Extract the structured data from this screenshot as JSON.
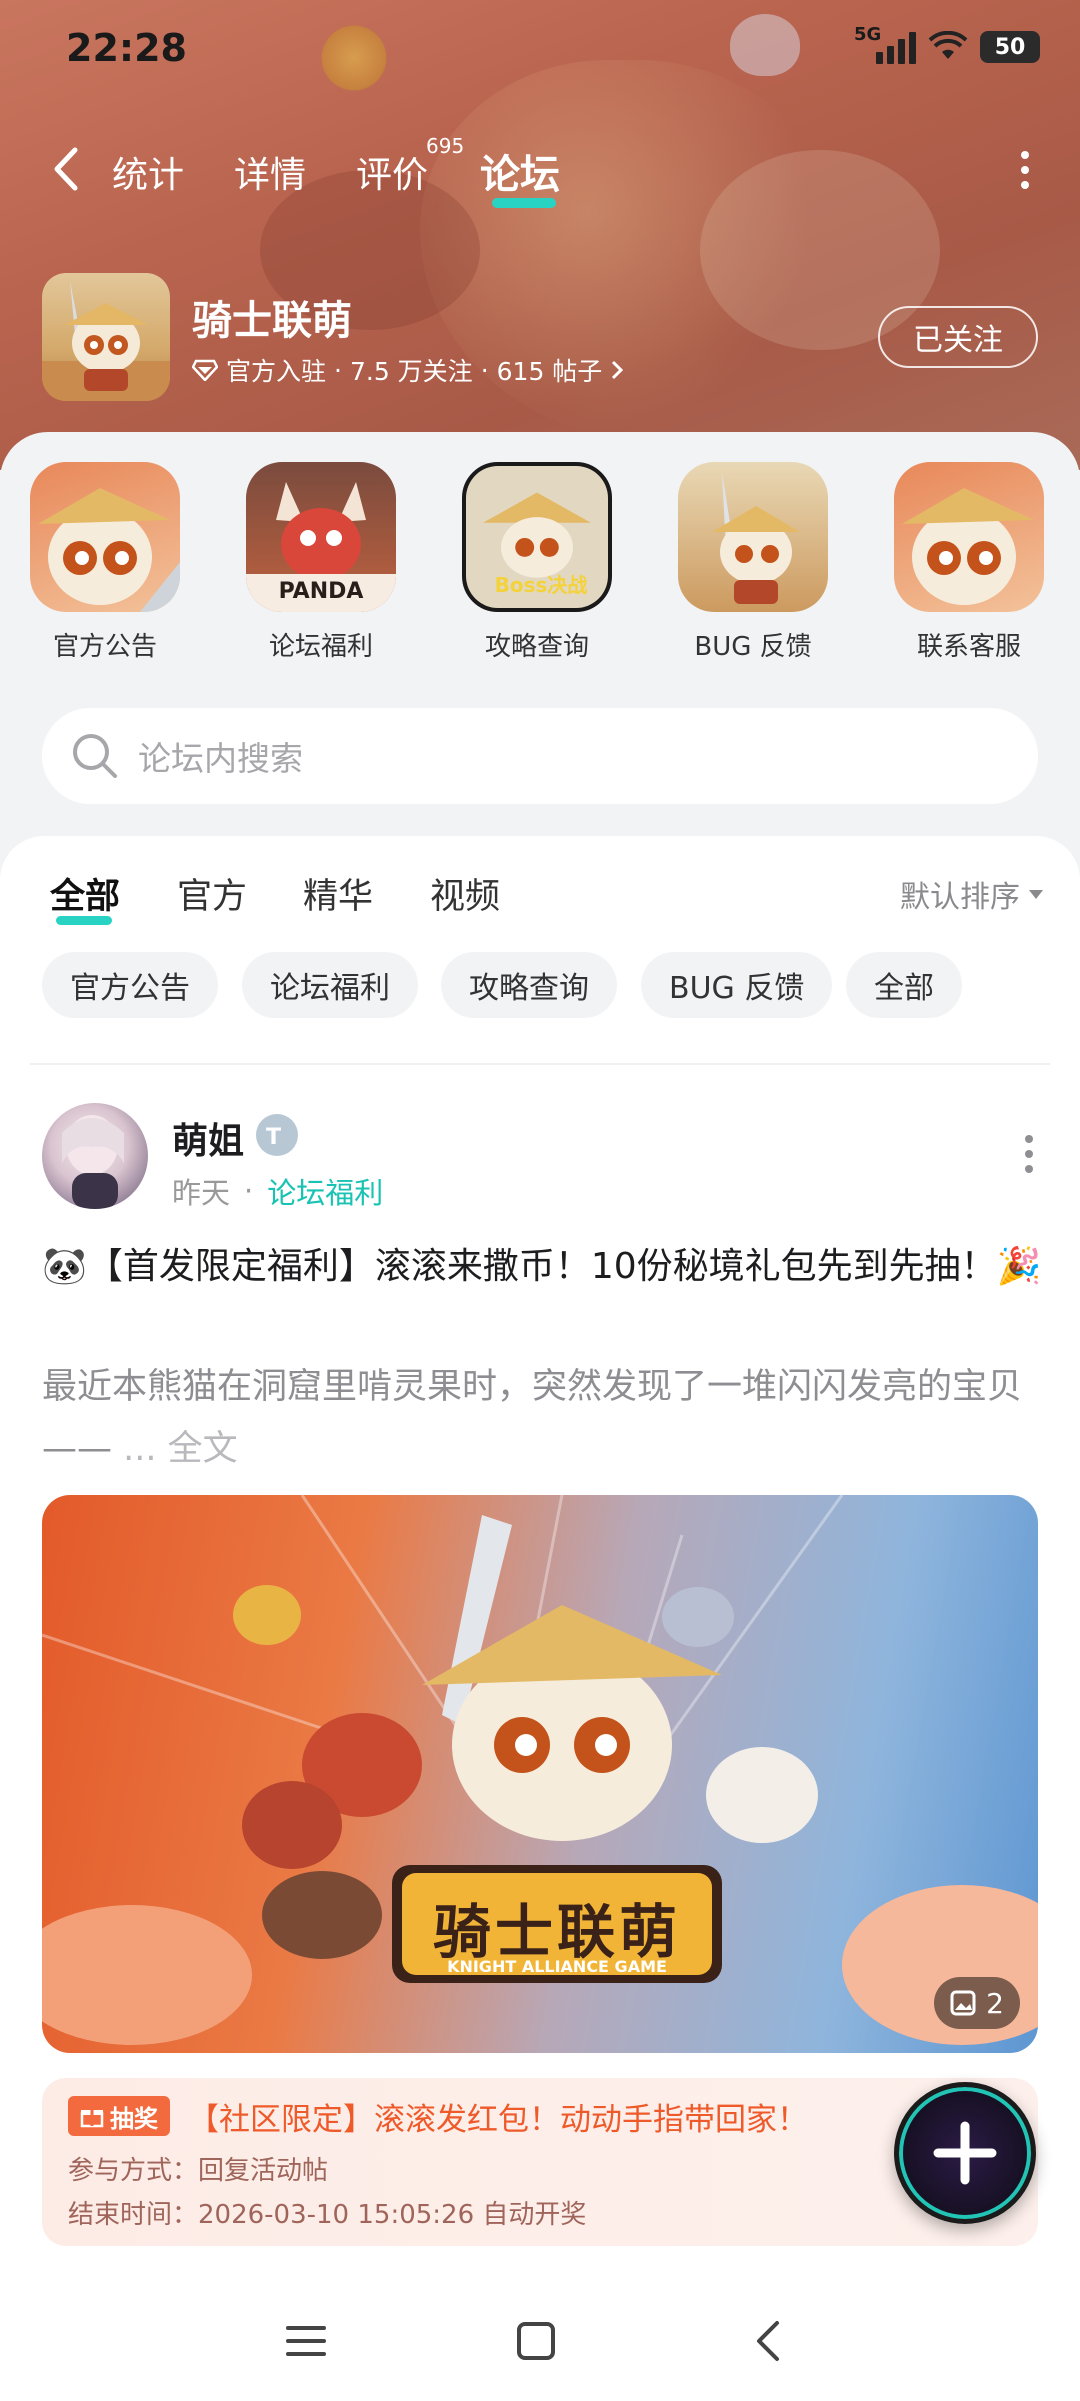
{
  "status_bar": {
    "time": "22:28",
    "network": "5G",
    "battery": "50"
  },
  "nav": {
    "tabs": [
      {
        "label": "统计"
      },
      {
        "label": "详情"
      },
      {
        "label": "评价",
        "badge": "695"
      },
      {
        "label": "论坛",
        "active": true
      }
    ]
  },
  "game": {
    "name": "骑士联萌",
    "meta": {
      "official": "官方入驻",
      "followers": "7.5 万关注",
      "posts": "615 帖子"
    },
    "follow_label": "已关注"
  },
  "shortcuts": [
    {
      "label": "官方公告"
    },
    {
      "label": "论坛福利",
      "thumb_text": "PANDA"
    },
    {
      "label": "攻略查询",
      "thumb_text": "Boss决战"
    },
    {
      "label": "BUG 反馈"
    },
    {
      "label": "联系客服"
    }
  ],
  "search": {
    "placeholder": "论坛内搜索"
  },
  "filter_tabs": [
    {
      "label": "全部",
      "active": true
    },
    {
      "label": "官方"
    },
    {
      "label": "精华"
    },
    {
      "label": "视频"
    }
  ],
  "sort_label": "默认排序",
  "chips": [
    "官方公告",
    "论坛福利",
    "攻略查询",
    "BUG 反馈",
    "全部"
  ],
  "post": {
    "author": "萌姐",
    "time": "昨天",
    "tag": "论坛福利",
    "title": "🐼【首发限定福利】滚滚来撒币！10份秘境礼包先到先抽！🎉",
    "excerpt": "最近本熊猫在洞窟里啃灵果时，突然发现了一堆闪闪发亮的宝贝——",
    "more": "... 全文",
    "image_count": "2",
    "image_title": "骑士联萌",
    "image_subtitle": "KNIGHT ALLIANCE GAME"
  },
  "lottery": {
    "badge": "抽奖",
    "title": "【社区限定】滚滚发红包！动动手指带回家！",
    "method": "参与方式：回复活动帖",
    "end": "结束时间：2026-03-10 15:05:26 自动开奖"
  },
  "colors": {
    "accent": "#29d3c4",
    "tag": "#19c3b3",
    "lottery": "#f26a3d"
  }
}
